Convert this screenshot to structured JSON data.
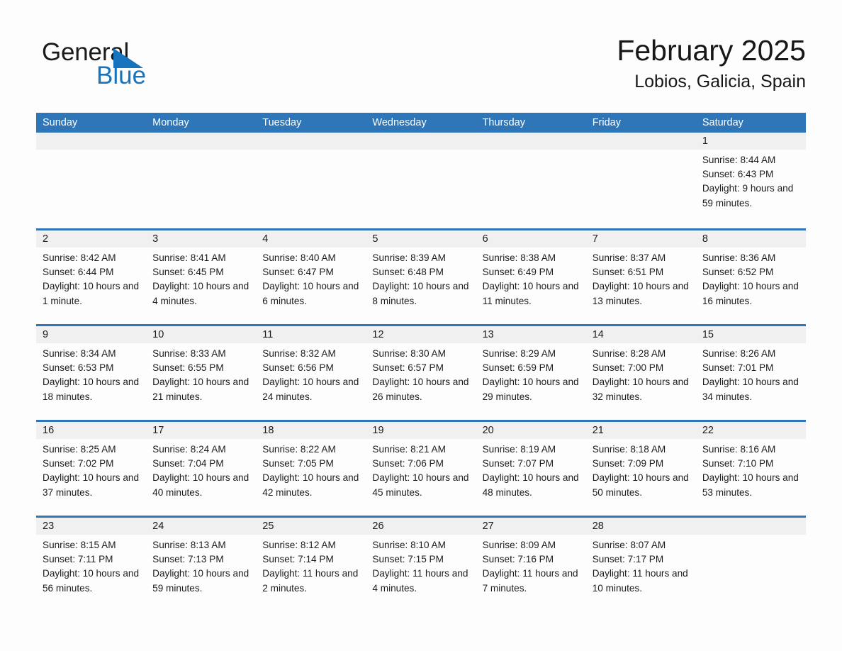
{
  "brand": {
    "name_part1": "General",
    "name_part2": "Blue",
    "triangle_color": "#1574bb",
    "blue_text_color": "#1574bb"
  },
  "header": {
    "title": "February 2025",
    "location": "Lobios, Galicia, Spain"
  },
  "theme": {
    "header_blue": "#2e76b8",
    "date_band_gray": "#f0f0f0",
    "page_background": "#fdfdfd",
    "text_color": "#1c1c1c"
  },
  "calendar": {
    "weekdays": [
      "Sunday",
      "Monday",
      "Tuesday",
      "Wednesday",
      "Thursday",
      "Friday",
      "Saturday"
    ],
    "weeks": [
      [
        {
          "date": "",
          "sunrise": "",
          "sunset": "",
          "daylight": ""
        },
        {
          "date": "",
          "sunrise": "",
          "sunset": "",
          "daylight": ""
        },
        {
          "date": "",
          "sunrise": "",
          "sunset": "",
          "daylight": ""
        },
        {
          "date": "",
          "sunrise": "",
          "sunset": "",
          "daylight": ""
        },
        {
          "date": "",
          "sunrise": "",
          "sunset": "",
          "daylight": ""
        },
        {
          "date": "",
          "sunrise": "",
          "sunset": "",
          "daylight": ""
        },
        {
          "date": "1",
          "sunrise": "Sunrise: 8:44 AM",
          "sunset": "Sunset: 6:43 PM",
          "daylight": "Daylight: 9 hours and 59 minutes."
        }
      ],
      [
        {
          "date": "2",
          "sunrise": "Sunrise: 8:42 AM",
          "sunset": "Sunset: 6:44 PM",
          "daylight": "Daylight: 10 hours and 1 minute."
        },
        {
          "date": "3",
          "sunrise": "Sunrise: 8:41 AM",
          "sunset": "Sunset: 6:45 PM",
          "daylight": "Daylight: 10 hours and 4 minutes."
        },
        {
          "date": "4",
          "sunrise": "Sunrise: 8:40 AM",
          "sunset": "Sunset: 6:47 PM",
          "daylight": "Daylight: 10 hours and 6 minutes."
        },
        {
          "date": "5",
          "sunrise": "Sunrise: 8:39 AM",
          "sunset": "Sunset: 6:48 PM",
          "daylight": "Daylight: 10 hours and 8 minutes."
        },
        {
          "date": "6",
          "sunrise": "Sunrise: 8:38 AM",
          "sunset": "Sunset: 6:49 PM",
          "daylight": "Daylight: 10 hours and 11 minutes."
        },
        {
          "date": "7",
          "sunrise": "Sunrise: 8:37 AM",
          "sunset": "Sunset: 6:51 PM",
          "daylight": "Daylight: 10 hours and 13 minutes."
        },
        {
          "date": "8",
          "sunrise": "Sunrise: 8:36 AM",
          "sunset": "Sunset: 6:52 PM",
          "daylight": "Daylight: 10 hours and 16 minutes."
        }
      ],
      [
        {
          "date": "9",
          "sunrise": "Sunrise: 8:34 AM",
          "sunset": "Sunset: 6:53 PM",
          "daylight": "Daylight: 10 hours and 18 minutes."
        },
        {
          "date": "10",
          "sunrise": "Sunrise: 8:33 AM",
          "sunset": "Sunset: 6:55 PM",
          "daylight": "Daylight: 10 hours and 21 minutes."
        },
        {
          "date": "11",
          "sunrise": "Sunrise: 8:32 AM",
          "sunset": "Sunset: 6:56 PM",
          "daylight": "Daylight: 10 hours and 24 minutes."
        },
        {
          "date": "12",
          "sunrise": "Sunrise: 8:30 AM",
          "sunset": "Sunset: 6:57 PM",
          "daylight": "Daylight: 10 hours and 26 minutes."
        },
        {
          "date": "13",
          "sunrise": "Sunrise: 8:29 AM",
          "sunset": "Sunset: 6:59 PM",
          "daylight": "Daylight: 10 hours and 29 minutes."
        },
        {
          "date": "14",
          "sunrise": "Sunrise: 8:28 AM",
          "sunset": "Sunset: 7:00 PM",
          "daylight": "Daylight: 10 hours and 32 minutes."
        },
        {
          "date": "15",
          "sunrise": "Sunrise: 8:26 AM",
          "sunset": "Sunset: 7:01 PM",
          "daylight": "Daylight: 10 hours and 34 minutes."
        }
      ],
      [
        {
          "date": "16",
          "sunrise": "Sunrise: 8:25 AM",
          "sunset": "Sunset: 7:02 PM",
          "daylight": "Daylight: 10 hours and 37 minutes."
        },
        {
          "date": "17",
          "sunrise": "Sunrise: 8:24 AM",
          "sunset": "Sunset: 7:04 PM",
          "daylight": "Daylight: 10 hours and 40 minutes."
        },
        {
          "date": "18",
          "sunrise": "Sunrise: 8:22 AM",
          "sunset": "Sunset: 7:05 PM",
          "daylight": "Daylight: 10 hours and 42 minutes."
        },
        {
          "date": "19",
          "sunrise": "Sunrise: 8:21 AM",
          "sunset": "Sunset: 7:06 PM",
          "daylight": "Daylight: 10 hours and 45 minutes."
        },
        {
          "date": "20",
          "sunrise": "Sunrise: 8:19 AM",
          "sunset": "Sunset: 7:07 PM",
          "daylight": "Daylight: 10 hours and 48 minutes."
        },
        {
          "date": "21",
          "sunrise": "Sunrise: 8:18 AM",
          "sunset": "Sunset: 7:09 PM",
          "daylight": "Daylight: 10 hours and 50 minutes."
        },
        {
          "date": "22",
          "sunrise": "Sunrise: 8:16 AM",
          "sunset": "Sunset: 7:10 PM",
          "daylight": "Daylight: 10 hours and 53 minutes."
        }
      ],
      [
        {
          "date": "23",
          "sunrise": "Sunrise: 8:15 AM",
          "sunset": "Sunset: 7:11 PM",
          "daylight": "Daylight: 10 hours and 56 minutes."
        },
        {
          "date": "24",
          "sunrise": "Sunrise: 8:13 AM",
          "sunset": "Sunset: 7:13 PM",
          "daylight": "Daylight: 10 hours and 59 minutes."
        },
        {
          "date": "25",
          "sunrise": "Sunrise: 8:12 AM",
          "sunset": "Sunset: 7:14 PM",
          "daylight": "Daylight: 11 hours and 2 minutes."
        },
        {
          "date": "26",
          "sunrise": "Sunrise: 8:10 AM",
          "sunset": "Sunset: 7:15 PM",
          "daylight": "Daylight: 11 hours and 4 minutes."
        },
        {
          "date": "27",
          "sunrise": "Sunrise: 8:09 AM",
          "sunset": "Sunset: 7:16 PM",
          "daylight": "Daylight: 11 hours and 7 minutes."
        },
        {
          "date": "28",
          "sunrise": "Sunrise: 8:07 AM",
          "sunset": "Sunset: 7:17 PM",
          "daylight": "Daylight: 11 hours and 10 minutes."
        },
        {
          "date": "",
          "sunrise": "",
          "sunset": "",
          "daylight": ""
        }
      ]
    ]
  }
}
